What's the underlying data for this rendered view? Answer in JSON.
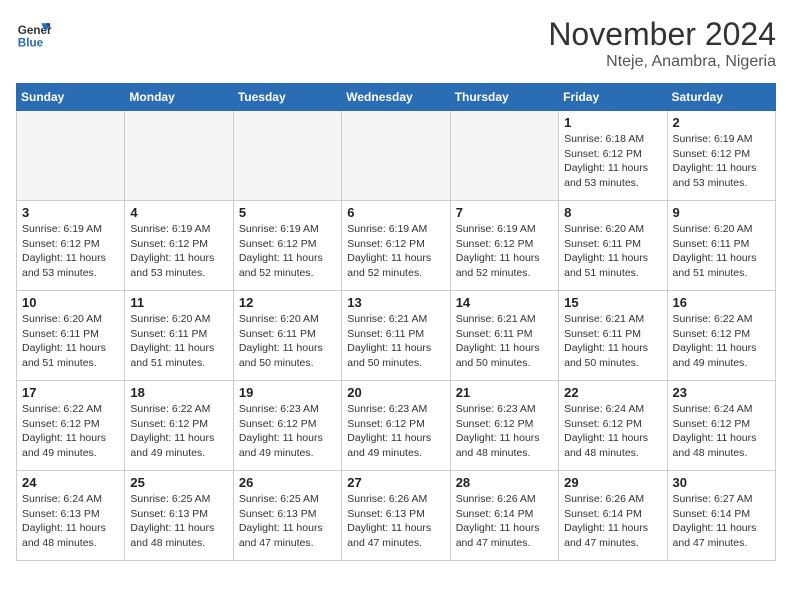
{
  "header": {
    "logo_line1": "General",
    "logo_line2": "Blue",
    "month_title": "November 2024",
    "location": "Nteje, Anambra, Nigeria"
  },
  "weekdays": [
    "Sunday",
    "Monday",
    "Tuesday",
    "Wednesday",
    "Thursday",
    "Friday",
    "Saturday"
  ],
  "weeks": [
    [
      {
        "day": "",
        "info": ""
      },
      {
        "day": "",
        "info": ""
      },
      {
        "day": "",
        "info": ""
      },
      {
        "day": "",
        "info": ""
      },
      {
        "day": "",
        "info": ""
      },
      {
        "day": "1",
        "info": "Sunrise: 6:18 AM\nSunset: 6:12 PM\nDaylight: 11 hours\nand 53 minutes."
      },
      {
        "day": "2",
        "info": "Sunrise: 6:19 AM\nSunset: 6:12 PM\nDaylight: 11 hours\nand 53 minutes."
      }
    ],
    [
      {
        "day": "3",
        "info": "Sunrise: 6:19 AM\nSunset: 6:12 PM\nDaylight: 11 hours\nand 53 minutes."
      },
      {
        "day": "4",
        "info": "Sunrise: 6:19 AM\nSunset: 6:12 PM\nDaylight: 11 hours\nand 53 minutes."
      },
      {
        "day": "5",
        "info": "Sunrise: 6:19 AM\nSunset: 6:12 PM\nDaylight: 11 hours\nand 52 minutes."
      },
      {
        "day": "6",
        "info": "Sunrise: 6:19 AM\nSunset: 6:12 PM\nDaylight: 11 hours\nand 52 minutes."
      },
      {
        "day": "7",
        "info": "Sunrise: 6:19 AM\nSunset: 6:12 PM\nDaylight: 11 hours\nand 52 minutes."
      },
      {
        "day": "8",
        "info": "Sunrise: 6:20 AM\nSunset: 6:11 PM\nDaylight: 11 hours\nand 51 minutes."
      },
      {
        "day": "9",
        "info": "Sunrise: 6:20 AM\nSunset: 6:11 PM\nDaylight: 11 hours\nand 51 minutes."
      }
    ],
    [
      {
        "day": "10",
        "info": "Sunrise: 6:20 AM\nSunset: 6:11 PM\nDaylight: 11 hours\nand 51 minutes."
      },
      {
        "day": "11",
        "info": "Sunrise: 6:20 AM\nSunset: 6:11 PM\nDaylight: 11 hours\nand 51 minutes."
      },
      {
        "day": "12",
        "info": "Sunrise: 6:20 AM\nSunset: 6:11 PM\nDaylight: 11 hours\nand 50 minutes."
      },
      {
        "day": "13",
        "info": "Sunrise: 6:21 AM\nSunset: 6:11 PM\nDaylight: 11 hours\nand 50 minutes."
      },
      {
        "day": "14",
        "info": "Sunrise: 6:21 AM\nSunset: 6:11 PM\nDaylight: 11 hours\nand 50 minutes."
      },
      {
        "day": "15",
        "info": "Sunrise: 6:21 AM\nSunset: 6:11 PM\nDaylight: 11 hours\nand 50 minutes."
      },
      {
        "day": "16",
        "info": "Sunrise: 6:22 AM\nSunset: 6:12 PM\nDaylight: 11 hours\nand 49 minutes."
      }
    ],
    [
      {
        "day": "17",
        "info": "Sunrise: 6:22 AM\nSunset: 6:12 PM\nDaylight: 11 hours\nand 49 minutes."
      },
      {
        "day": "18",
        "info": "Sunrise: 6:22 AM\nSunset: 6:12 PM\nDaylight: 11 hours\nand 49 minutes."
      },
      {
        "day": "19",
        "info": "Sunrise: 6:23 AM\nSunset: 6:12 PM\nDaylight: 11 hours\nand 49 minutes."
      },
      {
        "day": "20",
        "info": "Sunrise: 6:23 AM\nSunset: 6:12 PM\nDaylight: 11 hours\nand 49 minutes."
      },
      {
        "day": "21",
        "info": "Sunrise: 6:23 AM\nSunset: 6:12 PM\nDaylight: 11 hours\nand 48 minutes."
      },
      {
        "day": "22",
        "info": "Sunrise: 6:24 AM\nSunset: 6:12 PM\nDaylight: 11 hours\nand 48 minutes."
      },
      {
        "day": "23",
        "info": "Sunrise: 6:24 AM\nSunset: 6:12 PM\nDaylight: 11 hours\nand 48 minutes."
      }
    ],
    [
      {
        "day": "24",
        "info": "Sunrise: 6:24 AM\nSunset: 6:13 PM\nDaylight: 11 hours\nand 48 minutes."
      },
      {
        "day": "25",
        "info": "Sunrise: 6:25 AM\nSunset: 6:13 PM\nDaylight: 11 hours\nand 48 minutes."
      },
      {
        "day": "26",
        "info": "Sunrise: 6:25 AM\nSunset: 6:13 PM\nDaylight: 11 hours\nand 47 minutes."
      },
      {
        "day": "27",
        "info": "Sunrise: 6:26 AM\nSunset: 6:13 PM\nDaylight: 11 hours\nand 47 minutes."
      },
      {
        "day": "28",
        "info": "Sunrise: 6:26 AM\nSunset: 6:14 PM\nDaylight: 11 hours\nand 47 minutes."
      },
      {
        "day": "29",
        "info": "Sunrise: 6:26 AM\nSunset: 6:14 PM\nDaylight: 11 hours\nand 47 minutes."
      },
      {
        "day": "30",
        "info": "Sunrise: 6:27 AM\nSunset: 6:14 PM\nDaylight: 11 hours\nand 47 minutes."
      }
    ]
  ]
}
